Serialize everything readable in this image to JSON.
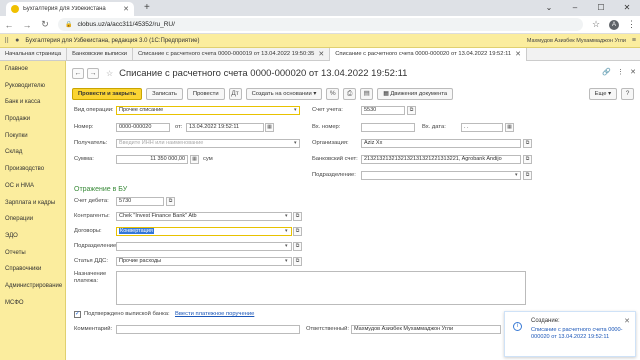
{
  "browser": {
    "tab_title": "Бухгалтерия для Узбекистана",
    "url": "clobus.uz/a/acc311/45352/ru_RU/",
    "avatar_letter": "A"
  },
  "app": {
    "title": "Бухгалтерия для Узбекистана, редакция 3.0  (1С:Предприятие)",
    "user": "Махмудов Азизбек Мухаммаджон Угли"
  },
  "doc_tabs": [
    "Начальная страница",
    "Банковские выписки",
    "Списание с расчетного счета 0000-000019 от 13.04.2022 19:50:35",
    "Списание с расчетного счета 0000-000020 от 13.04.2022 19:52:11"
  ],
  "sidebar": [
    "Главное",
    "Руководителю",
    "Банк и касса",
    "Продажи",
    "Покупки",
    "Склад",
    "Производство",
    "ОС и НМА",
    "Зарплата и кадры",
    "Операции",
    "ЭДО",
    "Отчеты",
    "Справочники",
    "Администрирование",
    "МСФО"
  ],
  "doc": {
    "title": "Списание с расчетного счета 0000-000020 от 13.04.2022 19:52:11"
  },
  "toolbar": {
    "post_close": "Провести и закрыть",
    "save": "Записать",
    "post": "Провести",
    "create_based": "Создать на основании",
    "doc_movements": "Движения документа",
    "more": "Еще"
  },
  "form": {
    "op_type_label": "Вид операции:",
    "op_type_value": "Прочее списание",
    "account_label": "Счет учета:",
    "account_value": "5530",
    "number_label": "Номер:",
    "number_value": "0000-000020",
    "from_label": "от:",
    "date_value": "13.04.2022 19:52:11",
    "in_number_label": "Вх. номер:",
    "in_date_label": "Вх. дата:",
    "in_date_value": ".  .",
    "recipient_label": "Получатель:",
    "recipient_placeholder": "Введите ИНН или наименование",
    "org_label": "Организация:",
    "org_value": "Aziz Xx",
    "sum_label": "Сумма:",
    "sum_value": "11 350 000,00",
    "sum_unit": "сум",
    "bank_account_label": "Банковский счет:",
    "bank_account_value": "2132132132132132131321221313221, Agrobank Andijo",
    "division_label": "Подразделение:",
    "section_title": "Отражение в БУ",
    "debit_label": "Счет дебета:",
    "debit_value": "5730",
    "counterparty_label": "Контрагенты:",
    "counterparty_value": "Chek \"Invest Finance Bank\" Atb",
    "contracts_label": "Договоры:",
    "contracts_value": "Конвертация",
    "division2_label": "Подразделение:",
    "dds_label": "Статья ДДС:",
    "dds_value": "Прочие расходы",
    "purpose_label": "Назначение платежа:",
    "confirmed_label": "Подтверждено выпиской банка:",
    "enter_order_link": "Ввести платежное поручение",
    "comment_label": "Комментарий:",
    "responsible_label": "Ответственный:",
    "responsible_value": "Махмудов Азизбек Мухаммаджон Угли"
  },
  "notification": {
    "title": "Создание:",
    "text": "Списание с расчетного счета 0000-000020 от 13.04.2022 19:52:11"
  }
}
